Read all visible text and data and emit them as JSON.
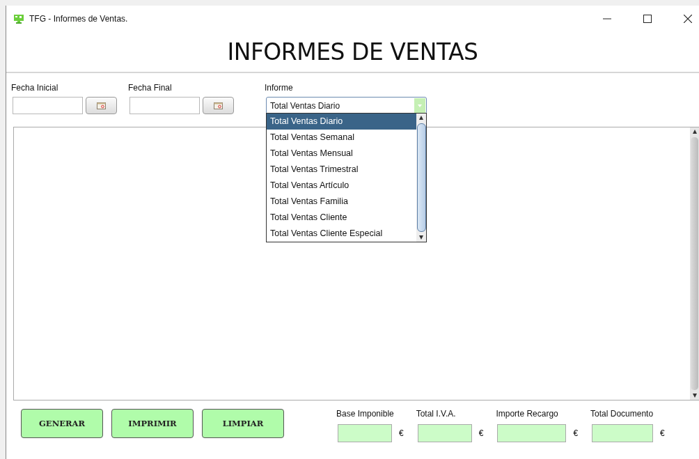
{
  "window": {
    "title": "TFG - Informes de Ventas."
  },
  "heading": "INFORMES DE VENTAS",
  "date_fields": [
    {
      "label": "Fecha Inicial"
    },
    {
      "label": "Fecha Final"
    }
  ],
  "report_select": {
    "label": "Informe",
    "value": "Total Ventas Diario",
    "expanded": true,
    "options": [
      {
        "label": "Total Ventas Diario",
        "selected": true
      },
      {
        "label": "Total Ventas Semanal",
        "selected": false
      },
      {
        "label": "Total Ventas Mensual",
        "selected": false
      },
      {
        "label": "Total Ventas Trimestral",
        "selected": false
      },
      {
        "label": "Total Ventas Artículo",
        "selected": false
      },
      {
        "label": "Total Ventas Familia",
        "selected": false
      },
      {
        "label": "Total Ventas Cliente",
        "selected": false
      },
      {
        "label": "Total Ventas Cliente Especial",
        "selected": false
      }
    ]
  },
  "buttons": [
    "GENERAR",
    "IMPRIMIR",
    "LIMPIAR"
  ],
  "totals": [
    {
      "label": "Base Imponible",
      "currency": "€"
    },
    {
      "label": "Total I.V.A.",
      "currency": "€"
    },
    {
      "label": "Importe Recargo",
      "currency": "€"
    },
    {
      "label": "Total Documento",
      "currency": "€"
    }
  ]
}
